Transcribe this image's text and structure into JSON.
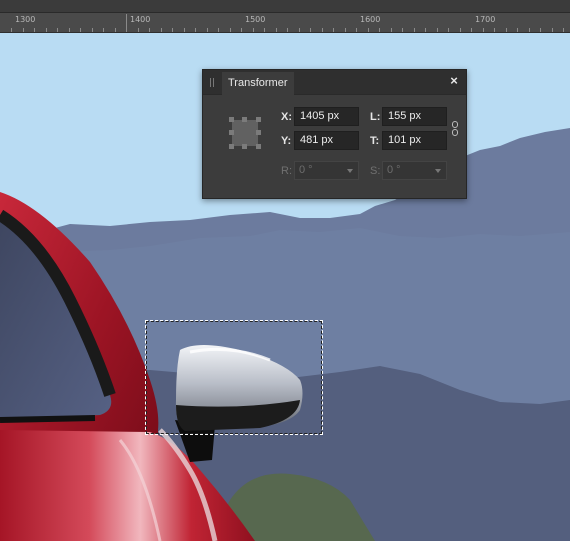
{
  "ruler": {
    "labels": [
      "1300",
      "1400",
      "1500",
      "1600",
      "1700"
    ]
  },
  "transformer": {
    "title": "Transformer",
    "close_glyph": "×",
    "x": {
      "label": "X:",
      "value": "1405 px"
    },
    "y": {
      "label": "Y:",
      "value": "481 px"
    },
    "w": {
      "label": "L:",
      "value": "155 px"
    },
    "h": {
      "label": "T:",
      "value": "101 px"
    },
    "r": {
      "label": "R:",
      "value": "0 °"
    },
    "s": {
      "label": "S:",
      "value": "0 °"
    }
  },
  "colors": {
    "sky": "#b9dcf3",
    "far_hills": "#6c7b9e",
    "mid_hills": "#6f7fa2",
    "near_hills": "#545f7e",
    "car_red": "#b0182a"
  },
  "icons": [
    "grip-icon",
    "close-icon",
    "anchor-icon",
    "link-icon",
    "chevron-down-icon"
  ]
}
